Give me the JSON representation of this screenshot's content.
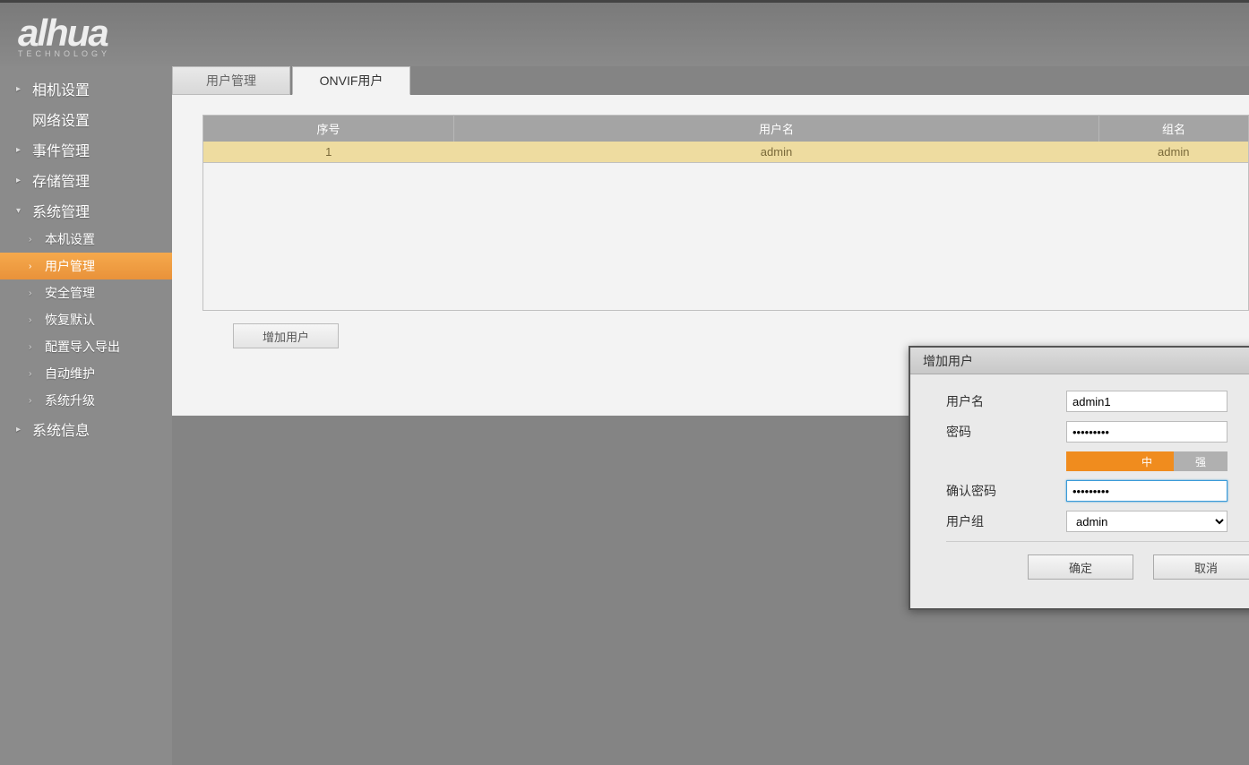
{
  "brand": {
    "name": "alhua",
    "sub": "TECHNOLOGY"
  },
  "sidebar": {
    "items": [
      {
        "label": "相机设置",
        "caret": "▸",
        "sub": false,
        "active": false
      },
      {
        "label": "网络设置",
        "caret": "",
        "sub": false,
        "active": false
      },
      {
        "label": "事件管理",
        "caret": "▸",
        "sub": false,
        "active": false
      },
      {
        "label": "存储管理",
        "caret": "▸",
        "sub": false,
        "active": false
      },
      {
        "label": "系统管理",
        "caret": "▾",
        "sub": false,
        "active": false
      },
      {
        "label": "本机设置",
        "caret": "›",
        "sub": true,
        "active": false
      },
      {
        "label": "用户管理",
        "caret": "›",
        "sub": true,
        "active": true
      },
      {
        "label": "安全管理",
        "caret": "›",
        "sub": true,
        "active": false
      },
      {
        "label": "恢复默认",
        "caret": "›",
        "sub": true,
        "active": false
      },
      {
        "label": "配置导入导出",
        "caret": "›",
        "sub": true,
        "active": false
      },
      {
        "label": "自动维护",
        "caret": "›",
        "sub": true,
        "active": false
      },
      {
        "label": "系统升级",
        "caret": "›",
        "sub": true,
        "active": false
      },
      {
        "label": "系统信息",
        "caret": "▸",
        "sub": false,
        "active": false
      }
    ]
  },
  "tabs": [
    {
      "label": "用户管理",
      "active": false
    },
    {
      "label": "ONVIF用户",
      "active": true
    }
  ],
  "table": {
    "headers": {
      "num": "序号",
      "user": "用户名",
      "group": "组名"
    },
    "rows": [
      {
        "num": "1",
        "user": "admin",
        "group": "admin"
      }
    ]
  },
  "buttons": {
    "add_user": "增加用户"
  },
  "dialog": {
    "title": "增加用户",
    "labels": {
      "username": "用户名",
      "password": "密码",
      "confirm": "确认密码",
      "group": "用户组"
    },
    "values": {
      "username": "admin1",
      "password": "•••••••••",
      "confirm": "•••••••••",
      "group": "admin"
    },
    "strength": {
      "low": "",
      "mid": "中",
      "high": "强"
    },
    "footer": {
      "ok": "确定",
      "cancel": "取消"
    }
  }
}
